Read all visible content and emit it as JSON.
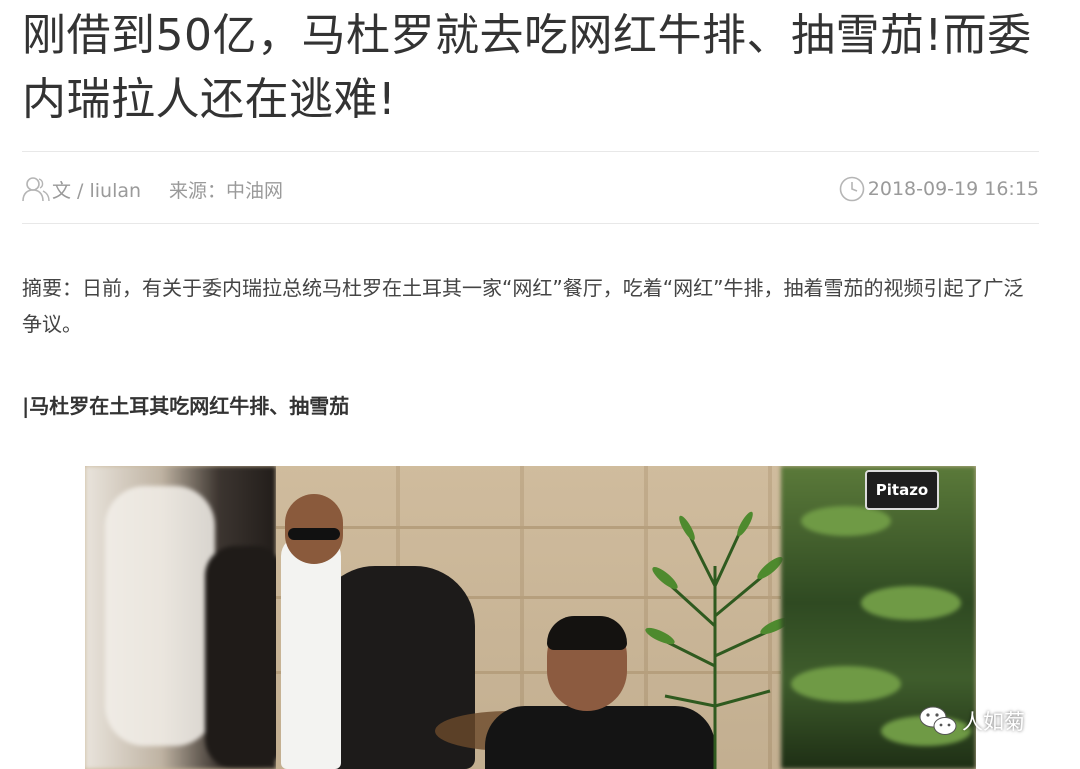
{
  "article": {
    "title": "刚借到50亿，马杜罗就去吃网红牛排、抽雪茄!而委内瑞拉人还在逃难!",
    "meta": {
      "author": "文 / liulan",
      "source": "来源：中油网",
      "date": "2018-09-19 16:15",
      "author_icon": "user-icon",
      "date_icon": "clock-icon"
    },
    "summary": "摘要：日前，有关于委内瑞拉总统马杜罗在土耳其一家“网红”餐厅，吃着“网红”牛排，抽着雪茄的视频引起了广泛争议。",
    "section_heading": "|马杜罗在土耳其吃网红牛排、抽雪茄",
    "image": {
      "logo_text": "Pitazo"
    },
    "watermark": {
      "icon": "wechat-icon",
      "text": "人如菊"
    },
    "colors": {
      "title": "#333333",
      "meta": "#9a9a9a",
      "rule": "#e8e8e8"
    }
  }
}
